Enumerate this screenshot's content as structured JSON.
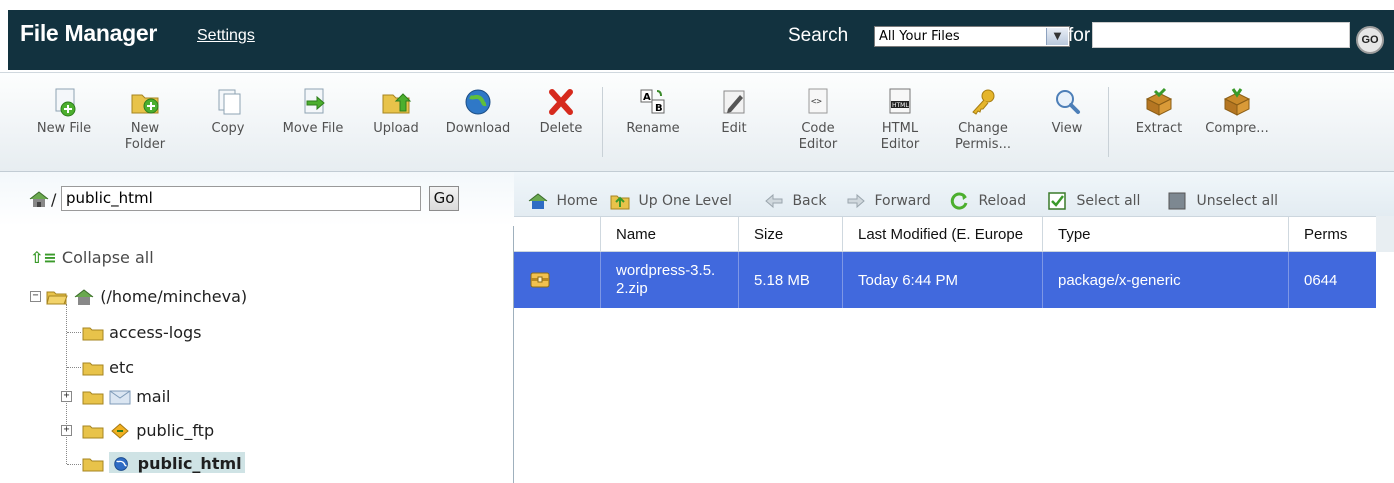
{
  "header": {
    "title": "File Manager",
    "settings_link": "Settings",
    "search_label": "Search",
    "search_scope": "All Your Files",
    "for_label": "for",
    "search_value": "",
    "go_label": "GO"
  },
  "toolbar": {
    "buttons": [
      {
        "label": "New File",
        "icon": "new-file-icon"
      },
      {
        "label": "New Folder",
        "icon": "new-folder-icon"
      },
      {
        "label": "Copy",
        "icon": "copy-icon"
      },
      {
        "label": "Move File",
        "icon": "move-file-icon"
      },
      {
        "label": "Upload",
        "icon": "upload-icon"
      },
      {
        "label": "Download",
        "icon": "download-icon"
      },
      {
        "label": "Delete",
        "icon": "delete-icon"
      },
      {
        "label": "Rename",
        "icon": "rename-icon"
      },
      {
        "label": "Edit",
        "icon": "edit-icon"
      },
      {
        "label": "Code Editor",
        "icon": "code-editor-icon"
      },
      {
        "label": "HTML Editor",
        "icon": "html-editor-icon"
      },
      {
        "label": "Change Permis...",
        "icon": "key-icon"
      },
      {
        "label": "View",
        "icon": "magnifier-icon"
      },
      {
        "label": "Extract",
        "icon": "extract-icon"
      },
      {
        "label": "Compre...",
        "icon": "compress-icon"
      }
    ]
  },
  "left": {
    "path_value": "public_html",
    "path_slash": "/",
    "go_label": "Go",
    "collapse_all": "Collapse all",
    "tree": {
      "root": "(/home/mincheva)",
      "children": [
        "access-logs",
        "etc",
        "mail",
        "public_ftp",
        "public_html"
      ]
    }
  },
  "right": {
    "nav": {
      "home": "Home",
      "up": "Up One Level",
      "back": "Back",
      "forward": "Forward",
      "reload": "Reload",
      "select_all": "Select all",
      "unselect_all": "Unselect all"
    },
    "columns": [
      "",
      "Name",
      "Size",
      "Last Modified (E. Europe",
      "Type",
      "Perms"
    ],
    "rows": [
      {
        "name": "wordpress-3.5.2.zip",
        "size": "5.18 MB",
        "modified": "Today 6:44 PM",
        "type": "package/x-generic",
        "perms": "0644"
      }
    ]
  },
  "colors": {
    "header_bg": "#12323f",
    "selected_row": "#4169dd"
  }
}
